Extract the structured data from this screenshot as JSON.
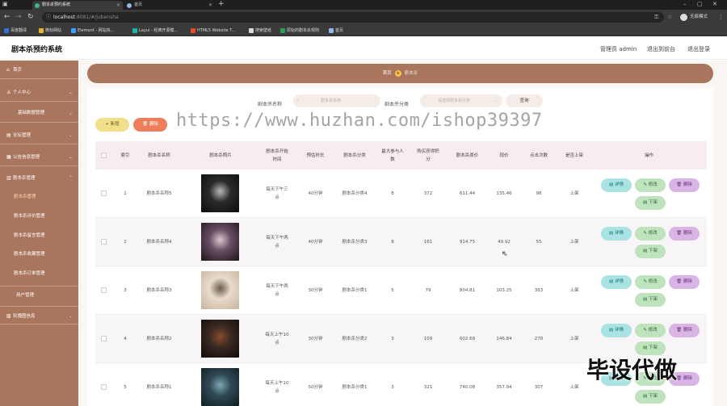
{
  "browser": {
    "tabs": [
      {
        "title": "剧本杀预约系统",
        "active": true
      },
      {
        "title": "首页",
        "active": false
      }
    ],
    "url_host": "localhost",
    "url_path": ":8081/#/jubensha",
    "profile_label": "无痕模式",
    "bookmarks": [
      "百度翻译",
      "微标网站",
      "Element - 网站快...",
      "Layui - 经典开源模...",
      "HTML5 Website T...",
      "搜索壁纸",
      "原始的剧本杀规则",
      "首页"
    ]
  },
  "header": {
    "title": "剧本杀预约系统",
    "user": "管理员 admin",
    "back_to_front": "退出到前台",
    "logout": "退出登录"
  },
  "sidebar": {
    "items": [
      {
        "label": "首页",
        "icon": "home-icon",
        "type": "top"
      },
      {
        "label": "个人中心",
        "icon": "user-icon",
        "type": "group"
      },
      {
        "label": "基础数据管理",
        "icon": "",
        "type": "plain"
      },
      {
        "label": "论坛管理",
        "icon": "forum-icon",
        "type": "group"
      },
      {
        "label": "公告信息管理",
        "icon": "notice-icon",
        "type": "group"
      },
      {
        "label": "剧本杀管理",
        "icon": "book-icon",
        "type": "group"
      }
    ],
    "sub_items": [
      {
        "label": "剧本杀管理",
        "active": true
      },
      {
        "label": "剧本杀评价管理",
        "active": false
      },
      {
        "label": "剧本杀留言管理",
        "active": false
      },
      {
        "label": "剧本杀收藏管理",
        "active": false
      },
      {
        "label": "剧本杀订单管理",
        "active": false
      }
    ],
    "user_manage": "用户管理",
    "carousel": "轮播图信息"
  },
  "breadcrumb": {
    "home": "首页",
    "current": "剧本杀"
  },
  "filters": {
    "name_label": "剧本杀名称",
    "name_placeholder": "剧本杀名称",
    "type_label": "剧本杀分类",
    "type_placeholder": "请选择剧本杀分类",
    "search_label": "查询"
  },
  "actions": {
    "add": "新增",
    "delete": "删除"
  },
  "table": {
    "headers": [
      "索引",
      "剧本杀名称",
      "剧本杀照片",
      "剧本杀开始\n时间",
      "预估时长",
      "剧本杀分类",
      "最大参与人\n数",
      "购买获得积\n分",
      "剧本杀原价",
      "现价",
      "点击次数",
      "是否上架",
      "操作"
    ],
    "rows": [
      {
        "index": "1",
        "name": "剧本杀名称5",
        "start": "每天下午三\n点",
        "duration": "40分钟",
        "type": "剧本杀分类4",
        "max": "8",
        "points": "372",
        "orig": "611.44",
        "price": "135.46",
        "clicks": "98",
        "status": "上架",
        "poster": [
          "#2b2b2b",
          "#0c0c0c",
          "#b8b8b8"
        ]
      },
      {
        "index": "2",
        "name": "剧本杀名称4",
        "start": "每天下午两\n点",
        "duration": "40分钟",
        "type": "剧本杀分类3",
        "max": "8",
        "points": "161",
        "orig": "914.75",
        "price": "49.92",
        "clicks": "55",
        "status": "上架",
        "poster": [
          "#6b4f64",
          "#1d1418",
          "#d9c9cf"
        ]
      },
      {
        "index": "3",
        "name": "剧本杀名称3",
        "start": "每天下午两\n点",
        "duration": "30分钟",
        "type": "剧本杀分类1",
        "max": "5",
        "points": "79",
        "orig": "804.81",
        "price": "103.25",
        "clicks": "363",
        "status": "上架",
        "poster": [
          "#e8dccd",
          "#c8b39a",
          "#6b5b4a"
        ]
      },
      {
        "index": "4",
        "name": "剧本杀名称2",
        "start": "每天上午10\n点",
        "duration": "30分钟",
        "type": "剧本杀分类2",
        "max": "3",
        "points": "109",
        "orig": "602.68",
        "price": "146.84",
        "clicks": "278",
        "status": "上架",
        "poster": [
          "#3a2a22",
          "#120c09",
          "#8a4b2a"
        ]
      },
      {
        "index": "5",
        "name": "剧本杀名称1",
        "start": "每天上午10\n点",
        "duration": "50分钟",
        "type": "剧本杀分类1",
        "max": "3",
        "points": "321",
        "orig": "740.08",
        "price": "357.94",
        "clicks": "307",
        "status": "上架",
        "poster": [
          "#2f4a55",
          "#101d22",
          "#7fa7b5"
        ]
      }
    ],
    "row_actions": {
      "detail": "详情",
      "edit": "修改",
      "delete": "删除",
      "offshelf": "下架"
    }
  },
  "overlay": {
    "watermark": "https://www.huzhan.com/ishop39397",
    "corner_text": "毕设代做"
  }
}
